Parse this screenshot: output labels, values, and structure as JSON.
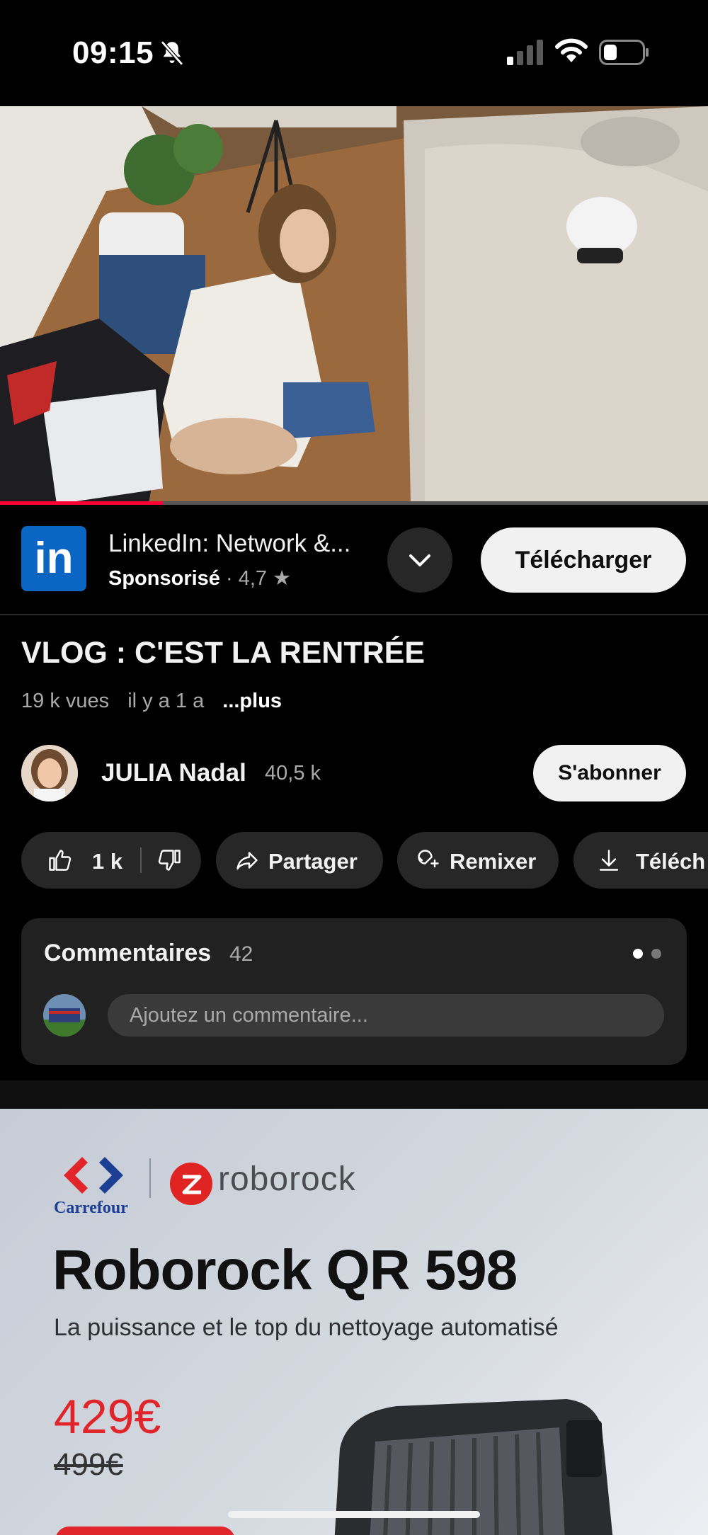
{
  "status_bar": {
    "time": "09:15"
  },
  "video": {
    "progress_percent": 23
  },
  "ad": {
    "app_name": "LinkedIn: Network &...",
    "logo_text": "in",
    "sponsored": "Sponsorisé",
    "separator": "·",
    "rating": "4,7",
    "star": "★",
    "cta": "Télécharger"
  },
  "video_info": {
    "title": "VLOG : C'EST LA RENTRÉE",
    "views": "19 k vues",
    "age": "il y a 1 a",
    "more": "...plus"
  },
  "channel": {
    "name": "JULIA Nadal",
    "subscribers": "40,5 k",
    "subscribe_label": "S'abonner"
  },
  "actions": {
    "likes": "1 k",
    "share": "Partager",
    "remix": "Remixer",
    "download": "Téléch"
  },
  "comments": {
    "title": "Commentaires",
    "count": "42",
    "placeholder": "Ajoutez un commentaire..."
  },
  "banner_ad": {
    "brand1": "Carrefour",
    "brand2": "roborock",
    "product": "Roborock QR 598",
    "tagline": "La puissance et le top du nettoyage automatisé",
    "price": "429€",
    "old_price": "499€",
    "colors": {
      "price": "#e0262b",
      "carrefour_blue": "#1c3f94"
    }
  },
  "colors": {
    "progress": "#ff0033",
    "linkedin": "#0a66c2"
  }
}
